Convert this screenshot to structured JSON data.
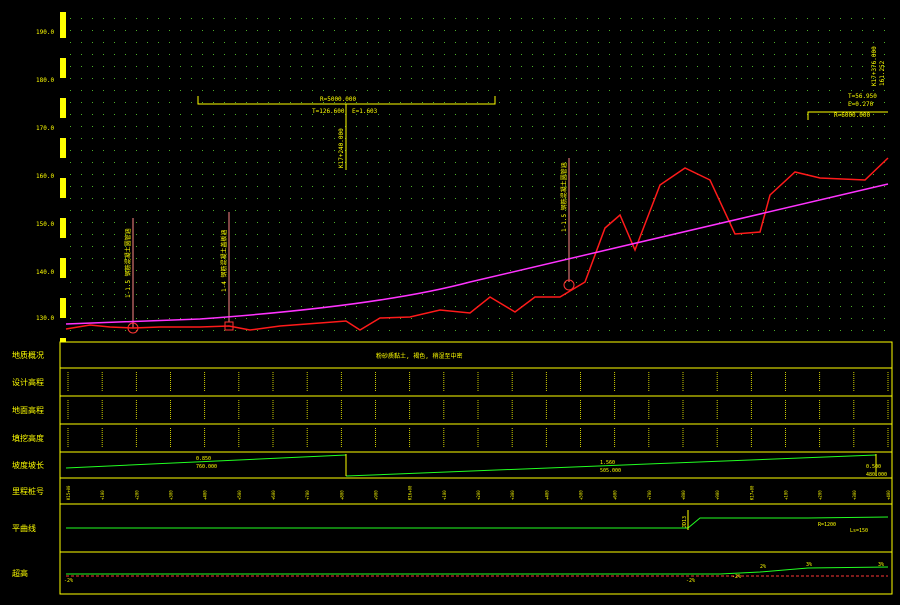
{
  "profile": {
    "y_axis_labels": [
      "190.0",
      "180.0",
      "170.0",
      "160.0",
      "150.0",
      "140.0",
      "130.0"
    ],
    "curve1": {
      "radius": "R=5000.000",
      "tangent": "T=126.600",
      "external": "E=1.603"
    },
    "curve2": {
      "radius": "R=6000.000",
      "tangent": "T=56.950",
      "external": "E=0.270"
    },
    "top_right_text": "K17+376.000",
    "top_right_text2": "161.252",
    "structures": [
      {
        "name": "structure-1",
        "label": "1-1.5 钢筋混凝土圆管涵"
      },
      {
        "name": "structure-2",
        "label": "1-4 钢筋混凝土盖板涵"
      },
      {
        "name": "structure-3",
        "label": "K17+240.000"
      },
      {
        "name": "structure-4",
        "label": "1-1.5 钢筋混凝土圆管涵"
      }
    ]
  },
  "table": {
    "rows": [
      "地质概况",
      "设计高程",
      "地面高程",
      "填挖高度",
      "坡度坡长",
      "里程桩号",
      "平曲线",
      "超高"
    ],
    "geology_note": "粉砂质黏土, 褐色, 稍湿至中密",
    "grade_labels": [
      "0.850",
      "1.560",
      "0.500"
    ],
    "grade_lengths": [
      "760.000",
      "505.000",
      "480.000"
    ],
    "station_values": [
      "K15+00",
      "+100",
      "+200",
      "+300",
      "+400",
      "+500",
      "+600",
      "+700",
      "+800",
      "+900",
      "K16+00",
      "+100",
      "+200",
      "+300",
      "+400",
      "+500",
      "+600",
      "+700",
      "+800",
      "+900",
      "K17+00",
      "+100",
      "+200",
      "+300",
      "+400"
    ],
    "curve_info": [
      "JD13",
      "R=1200",
      "Ls=150"
    ],
    "superelevation_labels": [
      "-2%",
      "-2%",
      "-2%",
      "2%",
      "3%",
      "3%"
    ]
  },
  "colors": {
    "grid": "#4caf28",
    "text": "#ffff00",
    "ground_line": "#ff1a1a",
    "design_line": "#ff33ff",
    "green_line": "#22ff22"
  }
}
